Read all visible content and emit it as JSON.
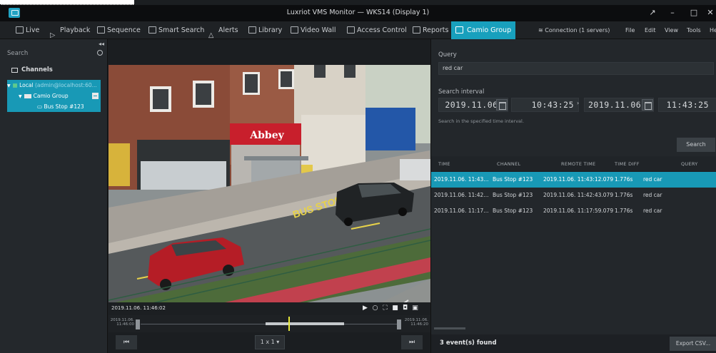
{
  "window": {
    "title": "Luxriot VMS Monitor — WKS14 (Display 1)",
    "controls": [
      "↗",
      "–",
      "□",
      "✕"
    ]
  },
  "menu": {
    "items": [
      {
        "label": "Live",
        "icon": "monitor-icon"
      },
      {
        "label": "Playback",
        "icon": "play-icon"
      },
      {
        "label": "Sequence",
        "icon": "sequence-icon"
      },
      {
        "label": "Smart Search",
        "icon": "smart-search-icon"
      },
      {
        "label": "Alerts",
        "icon": "bell-icon"
      },
      {
        "label": "Library",
        "icon": "library-icon"
      },
      {
        "label": "Video Wall",
        "icon": "video-wall-icon"
      },
      {
        "label": "Access Control",
        "icon": "door-icon"
      },
      {
        "label": "Reports",
        "icon": "chart-icon"
      },
      {
        "label": "Camio Group",
        "icon": "camio-icon"
      }
    ],
    "connection": "Connection (1 servers)",
    "file": "File",
    "edit": "Edit",
    "view": "View",
    "tools": "Tools",
    "help": "Help"
  },
  "sidebar": {
    "search_placeholder": "Search",
    "channels_title": "Channels",
    "tree": {
      "local": "Local",
      "local_suffix": "(admin@localhost:60...",
      "group": "Camio Group",
      "channel": "Bus Stop #123"
    }
  },
  "video": {
    "timestamp": "2019.11.06. 11:46:02",
    "layout": "1 x 1",
    "timeline_start": [
      "2019.11.06.",
      "11:46:00"
    ],
    "timeline_end": [
      "2019.11.06.",
      "11:46:20"
    ]
  },
  "query": {
    "label": "Query",
    "value": "red car",
    "interval_label": "Search interval",
    "from_date": "2019.11.06.",
    "from_time": "10:43:25",
    "to_date": "2019.11.06.",
    "to_time": "11:43:25",
    "hint": "Search in the specified time interval.",
    "search_button": "Search"
  },
  "results": {
    "columns": [
      "TIME",
      "CHANNEL",
      "REMOTE TIME",
      "TIME DIFF",
      "QUERY"
    ],
    "rows": [
      {
        "time": "2019.11.06. 11:43...",
        "channel": "Bus Stop #123",
        "remote": "2019.11.06. 11:43:12.079",
        "diff": "1.776s",
        "query": "red car"
      },
      {
        "time": "2019.11.06. 11:42...",
        "channel": "Bus Stop #123",
        "remote": "2019.11.06. 11:42:43.079",
        "diff": "1.776s",
        "query": "red car"
      },
      {
        "time": "2019.11.06. 11:17...",
        "channel": "Bus Stop #123",
        "remote": "2019.11.06. 11:17:59.079",
        "diff": "1.776s",
        "query": "red car"
      }
    ],
    "count": "3 event(s) found",
    "export": "Export CSV..."
  },
  "scene": {
    "sign_abbey": "Abbey",
    "road_text": "BUS STOP"
  },
  "colors": {
    "accent": "#1899b6",
    "marker": "#e6e83a"
  }
}
